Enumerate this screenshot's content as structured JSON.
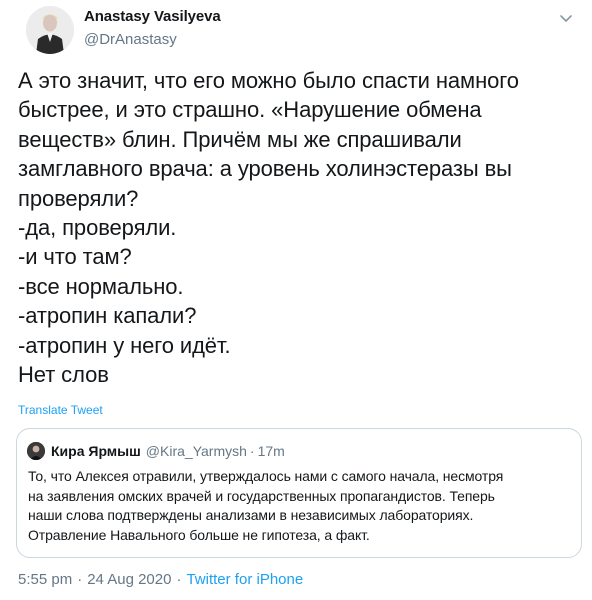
{
  "author": {
    "display_name": "Anastasy Vasilyeva",
    "handle": "@DrAnastasy"
  },
  "tweet": {
    "lines": [
      "А это значит, что его можно было спасти намного",
      "быстрее, и это страшно. «Нарушение обмена",
      "веществ» блин. Причём мы же спрашивали",
      "замглавного врача: а уровень холинэстеразы вы",
      "проверяли?",
      "-да, проверяли.",
      "-и что там?",
      "-все нормально.",
      "-атропин капали?",
      "-атропин у него идёт.",
      "Нет слов"
    ],
    "translate_label": "Translate Tweet"
  },
  "quoted_tweet": {
    "display_name": "Кира Ярмыш",
    "handle": "@Kira_Yarmysh",
    "separator": "·",
    "time": "17m",
    "lines": [
      "То, что Алексея отравили, утверждалось нами с самого начала, несмотря",
      "на заявления омских врачей и государственных пропагандистов. Теперь",
      "наши слова подтверждены анализами в независимых лабораториях.",
      "Отравление Навального больше не гипотеза, а факт."
    ]
  },
  "footer": {
    "time": "5:55 pm",
    "separator": "·",
    "date": "24 Aug 2020",
    "source": "Twitter for iPhone"
  },
  "colors": {
    "text": "#14171a",
    "secondary": "#657786",
    "link": "#1da1f2",
    "border": "#ccd6dd"
  },
  "icons": {
    "menu": "chevron-down-icon"
  }
}
